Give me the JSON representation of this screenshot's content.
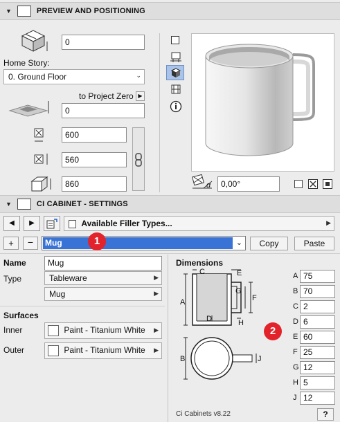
{
  "preview": {
    "title": "PREVIEW AND POSITIONING",
    "elevation_value": "0",
    "home_story_label": "Home Story:",
    "home_story_value": "0. Ground Floor",
    "project_zero_label": "to Project Zero",
    "project_zero_value": "0",
    "width_value": "600",
    "depth_value": "560",
    "height_value": "860",
    "angle_value": "0,00°",
    "alpha_label": "α"
  },
  "settings": {
    "title": "CI CABINET - SETTINGS",
    "filler_label": "Available Filler Types...",
    "selected_item": "Mug",
    "copy_label": "Copy",
    "paste_label": "Paste",
    "name_label": "Name",
    "name_value": "Mug",
    "type_label": "Type",
    "type_value": "Tableware",
    "subtype_value": "Mug",
    "surfaces_label": "Surfaces",
    "inner_label": "Inner",
    "inner_value": "Paint - Titanium White",
    "outer_label": "Outer",
    "outer_value": "Paint - Titanium White",
    "dimensions_label": "Dimensions",
    "dims": [
      {
        "k": "A",
        "v": "75"
      },
      {
        "k": "B",
        "v": "70"
      },
      {
        "k": "C",
        "v": "2"
      },
      {
        "k": "D",
        "v": "6"
      },
      {
        "k": "E",
        "v": "60"
      },
      {
        "k": "F",
        "v": "25"
      },
      {
        "k": "G",
        "v": "12"
      },
      {
        "k": "H",
        "v": "5"
      },
      {
        "k": "J",
        "v": "12"
      }
    ],
    "diagram_labels": {
      "a": "A",
      "b": "B",
      "c": "C",
      "d": "D",
      "e": "E",
      "f": "F",
      "g": "G",
      "h": "H",
      "j": "J"
    },
    "version": "Ci Cabinets v8.22",
    "help": "?"
  },
  "badges": {
    "one": "1",
    "two": "2"
  }
}
